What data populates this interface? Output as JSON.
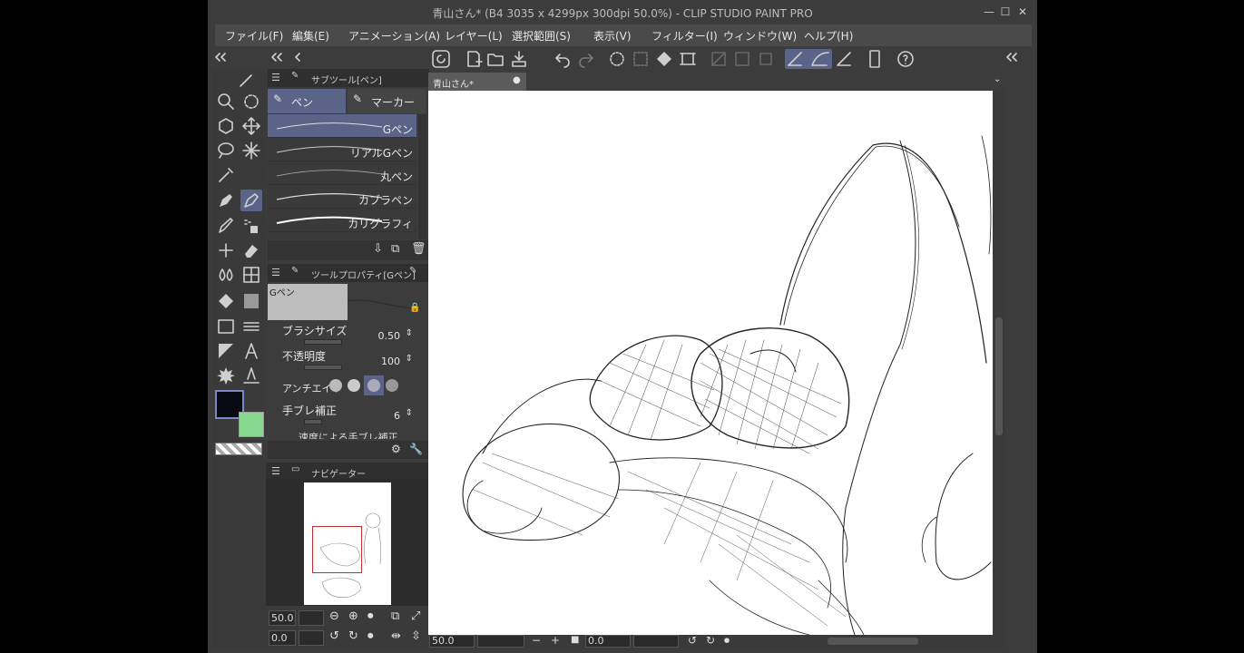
{
  "window": {
    "title": "青山さん* (B4 3035 x 4299px 300dpi 50.0%)  - CLIP STUDIO PAINT PRO",
    "minimize": "—",
    "maximize": "☐",
    "close": "✕"
  },
  "menu": {
    "items": [
      "ファイル(F)",
      "編集(E)",
      "アニメーション(A)",
      "レイヤー(L)",
      "選択範囲(S)",
      "表示(V)",
      "フィルター(I)",
      "ウィンドウ(W)",
      "ヘルプ(H)"
    ]
  },
  "subtool_panel": {
    "title": "サブツール[ペン]",
    "tabs": [
      "ペン",
      "マーカー"
    ],
    "brushes": [
      "Gペン",
      "リアルGペン",
      "丸ペン",
      "カブラペン",
      "カリグラフィ"
    ]
  },
  "tool_property": {
    "title": "ツールプロパティ[Gペン]",
    "preview_label": "Gペン",
    "brush_size_label": "ブラシサイズ",
    "brush_size_value": "0.50",
    "opacity_label": "不透明度",
    "opacity_value": "100",
    "antialias_label": "アンチエイリ",
    "stabilization_label": "手ブレ補正",
    "stabilization_value": "6",
    "speed_stabilization_label": "速度による手ブレ補正"
  },
  "navigator": {
    "title": "ナビゲーター",
    "zoom": "50.0",
    "rotation": "0.0"
  },
  "canvas": {
    "tab_label": "青山さん*",
    "zoom": "50.0",
    "rotation": "0.0"
  },
  "colors": {
    "main_color": "#0a0a14",
    "sub_color": "#86d88f",
    "accent": "#5a6488"
  }
}
